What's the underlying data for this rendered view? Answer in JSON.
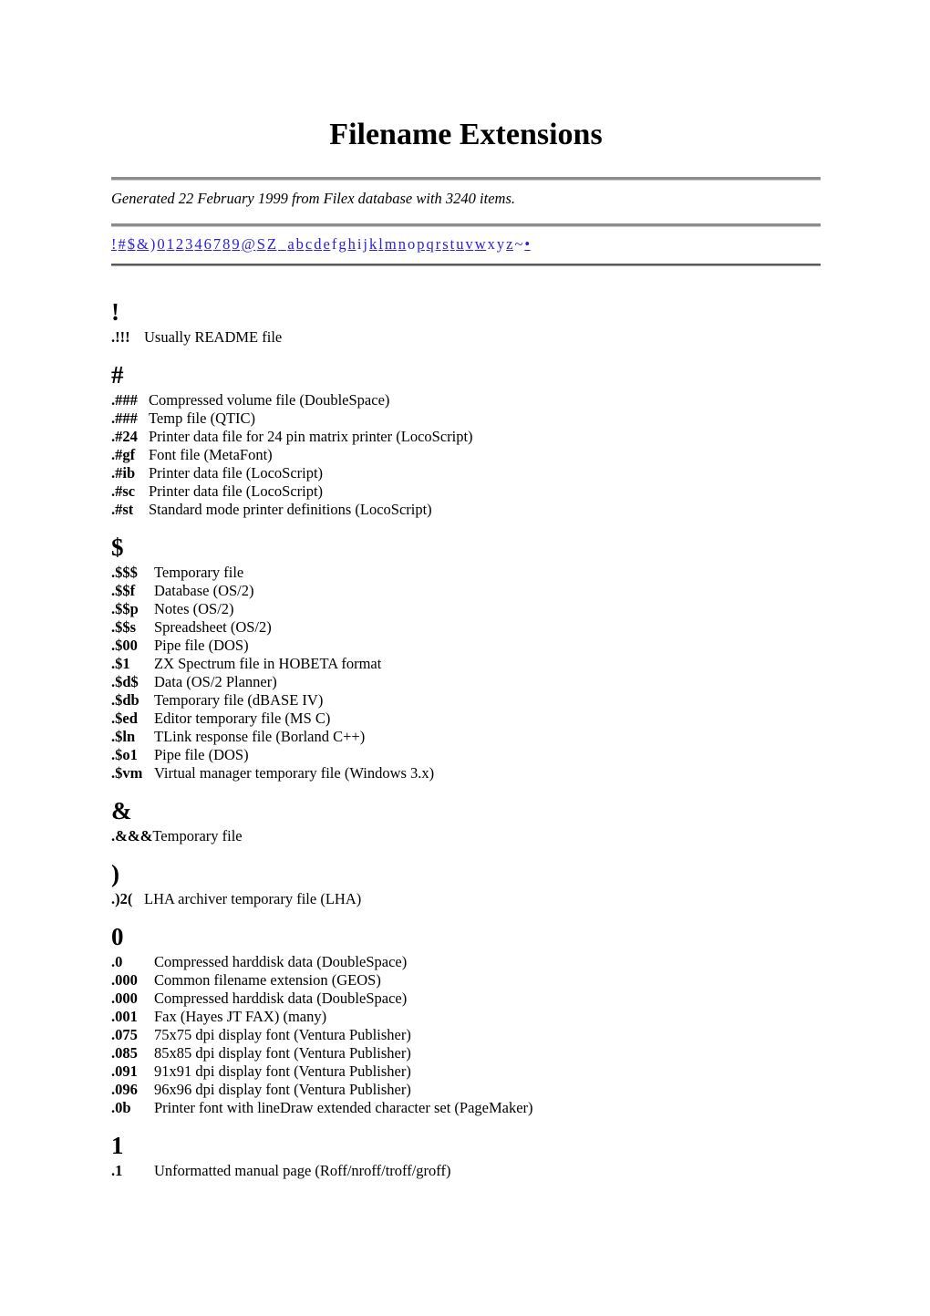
{
  "document": {
    "title": "Filename Extensions",
    "subtitle": "Generated 22 February 1999 from Filex database with 3240 items."
  },
  "index_nav": {
    "links": [
      "!",
      "#",
      "$",
      "&",
      ")",
      "0",
      "1",
      "2",
      "3",
      "4",
      "6",
      "7",
      "8",
      "9",
      "@",
      "S",
      "Z",
      "_",
      "a",
      "b",
      "c",
      "d",
      "e",
      "f",
      "g",
      "h",
      "i",
      "j",
      "k",
      "l",
      "m",
      "n",
      "o",
      "p",
      "q",
      "r",
      "s",
      "t",
      "u",
      "v",
      "w",
      "x",
      "y",
      "z",
      "~",
      "•"
    ],
    "link_color": "#2a1fd4"
  },
  "sections": [
    {
      "letter": "!",
      "width_class": "w-small",
      "entries": [
        {
          "ext": ".!!!",
          "desc": "Usually README file"
        }
      ]
    },
    {
      "letter": "#",
      "width_class": "w-med",
      "entries": [
        {
          "ext": ".###",
          "desc": "Compressed volume file (DoubleSpace)"
        },
        {
          "ext": ".###",
          "desc": "Temp file (QTIC)"
        },
        {
          "ext": ".#24",
          "desc": "Printer data file for 24 pin matrix printer (LocoScript)"
        },
        {
          "ext": ".#gf",
          "desc": "Font file (MetaFont)"
        },
        {
          "ext": ".#ib",
          "desc": "Printer data file (LocoScript)"
        },
        {
          "ext": ".#sc",
          "desc": "Printer data file (LocoScript)"
        },
        {
          "ext": ".#st",
          "desc": "Standard mode printer definitions (LocoScript)"
        }
      ]
    },
    {
      "letter": "$",
      "width_class": "w-wide",
      "entries": [
        {
          "ext": ".$$$",
          "desc": "Temporary file"
        },
        {
          "ext": ".$$f",
          "desc": "Database (OS/2)"
        },
        {
          "ext": ".$$p",
          "desc": "Notes (OS/2)"
        },
        {
          "ext": ".$$s",
          "desc": "Spreadsheet (OS/2)"
        },
        {
          "ext": ".$00",
          "desc": "Pipe file (DOS)"
        },
        {
          "ext": ".$1",
          "desc": "ZX Spectrum file in HOBETA format"
        },
        {
          "ext": ".$d$",
          "desc": "Data (OS/2 Planner)"
        },
        {
          "ext": ".$db",
          "desc": "Temporary file (dBASE IV)"
        },
        {
          "ext": ".$ed",
          "desc": "Editor temporary file (MS C)"
        },
        {
          "ext": ".$ln",
          "desc": "TLink response file (Borland C++)"
        },
        {
          "ext": ".$o1",
          "desc": "Pipe file (DOS)"
        },
        {
          "ext": ".$vm",
          "desc": "Virtual manager temporary file (Windows 3.x)"
        }
      ]
    },
    {
      "letter": "&",
      "width_class": "w-med",
      "entries": [
        {
          "ext": ".&&&",
          "desc": "Temporary file"
        }
      ]
    },
    {
      "letter": ")",
      "width_class": "w-small",
      "entries": [
        {
          "ext": ".)2(",
          "desc": "LHA archiver temporary file (LHA)"
        }
      ]
    },
    {
      "letter": "0",
      "width_class": "w-wide",
      "entries": [
        {
          "ext": ".0",
          "desc": "Compressed harddisk data (DoubleSpace)"
        },
        {
          "ext": ".000",
          "desc": "Common filename extension (GEOS)"
        },
        {
          "ext": ".000",
          "desc": "Compressed harddisk data (DoubleSpace)"
        },
        {
          "ext": ".001",
          "desc": "Fax (Hayes JT FAX) (many)"
        },
        {
          "ext": ".075",
          "desc": "75x75 dpi display font (Ventura Publisher)"
        },
        {
          "ext": ".085",
          "desc": "85x85 dpi display font (Ventura Publisher)"
        },
        {
          "ext": ".091",
          "desc": "91x91 dpi display font (Ventura Publisher)"
        },
        {
          "ext": ".096",
          "desc": "96x96 dpi display font (Ventura Publisher)"
        },
        {
          "ext": ".0b",
          "desc": "Printer font with lineDraw extended character set (PageMaker)"
        }
      ]
    },
    {
      "letter": "1",
      "width_class": "w-wide",
      "entries": [
        {
          "ext": ".1",
          "desc": "Unformatted manual page (Roff/nroff/troff/groff)"
        }
      ]
    }
  ]
}
